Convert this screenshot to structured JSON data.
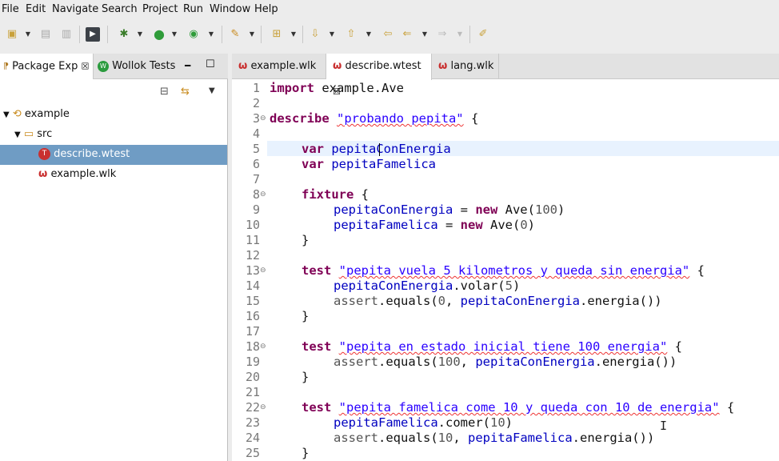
{
  "menu": [
    "File",
    "Edit",
    "Navigate",
    "Search",
    "Project",
    "Run",
    "Window",
    "Help"
  ],
  "left_panel": {
    "tabs": [
      {
        "label": "Package Exp",
        "close": "☒"
      },
      {
        "label": "Wollok Tests"
      }
    ],
    "tree": [
      {
        "label": "example",
        "icon": "project-icon"
      },
      {
        "label": "src",
        "icon": "folder-icon"
      },
      {
        "label": "describe.wtest",
        "icon": "wtest-file-icon"
      },
      {
        "label": "example.wlk",
        "icon": "wlk-file-icon"
      }
    ]
  },
  "editor": {
    "tabs": [
      {
        "label": "example.wlk",
        "active": false
      },
      {
        "label": "describe.wtest",
        "active": true,
        "close": "☒"
      },
      {
        "label": "lang.wlk",
        "active": false
      }
    ],
    "line_numbers": [
      "1",
      "2",
      "3",
      "4",
      "5",
      "6",
      "7",
      "8",
      "9",
      "10",
      "11",
      "12",
      "13",
      "14",
      "15",
      "16",
      "17",
      "18",
      "19",
      "20",
      "21",
      "22",
      "23",
      "24",
      "25"
    ],
    "code": {
      "l1a": "import",
      "l1b": " example.Ave",
      "l3a": "describe",
      "l3b": "\"probando pepita\"",
      "l3c": " {",
      "l5a": "var",
      "l5b": "pepitaConEnergia",
      "l6a": "var",
      "l6b": "pepitaFamelica",
      "l8a": "fixture",
      "l8b": " {",
      "l9a": "pepitaConEnergia",
      "l9b": " = ",
      "l9c": "new",
      "l9d": " Ave(",
      "l9e": "100",
      "l9f": ")",
      "l10a": "pepitaFamelica",
      "l10b": " = ",
      "l10c": "new",
      "l10d": " Ave(",
      "l10e": "0",
      "l10f": ")",
      "l11": "}",
      "l13a": "test",
      "l13b": "\"pepita vuela 5 kilometros y queda sin energia\"",
      "l13c": " {",
      "l14a": "pepitaConEnergia",
      "l14b": ".volar(",
      "l14c": "5",
      "l14d": ")",
      "l15a": "assert",
      "l15b": ".equals(",
      "l15c": "0",
      "l15d": ", ",
      "l15e": "pepitaConEnergia",
      "l15f": ".energia())",
      "l16": "}",
      "l18a": "test",
      "l18b": "\"pepita en estado inicial tiene 100 energia\"",
      "l18c": " {",
      "l19a": "assert",
      "l19b": ".equals(",
      "l19c": "100",
      "l19d": ", ",
      "l19e": "pepitaConEnergia",
      "l19f": ".energia())",
      "l20": "}",
      "l22a": "test",
      "l22b": "\"pepita famelica come 10 y queda con 10 de energia\"",
      "l22c": " {",
      "l23a": "pepitaFamelica",
      "l23b": ".comer(",
      "l23c": "10",
      "l23d": ")",
      "l24a": "assert",
      "l24b": ".equals(",
      "l24c": "10",
      "l24d": ", ",
      "l24e": "pepitaFamelica",
      "l24f": ".energia())",
      "l25": "}"
    }
  },
  "colors": {
    "keyword": "#7f0055",
    "string": "#2a00ff",
    "field": "#0000c0",
    "selection": "#6f9cc4",
    "current_line": "#e8f2fe"
  }
}
